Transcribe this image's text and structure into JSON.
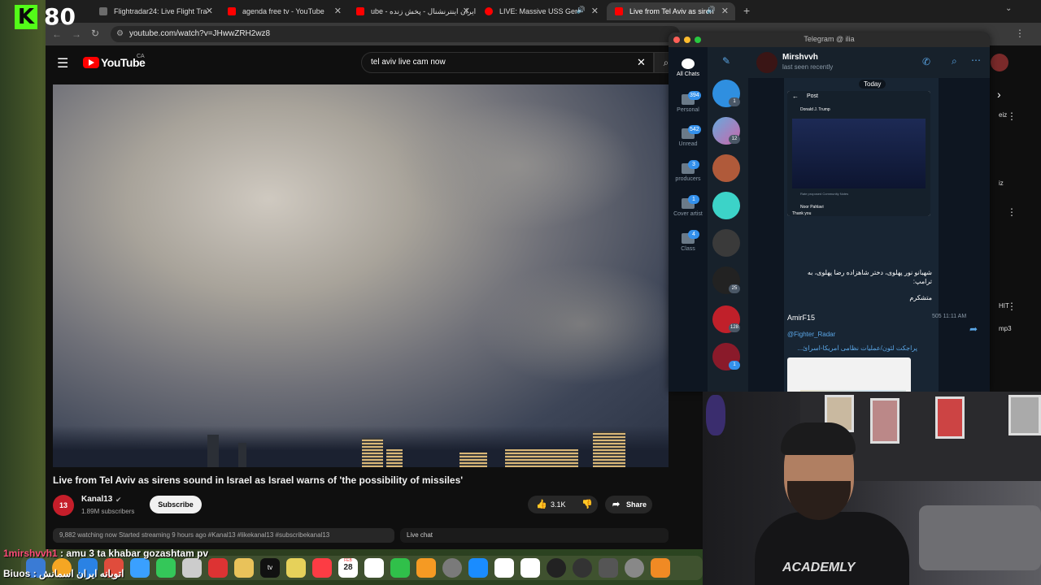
{
  "stream": {
    "kick_logo": "K",
    "viewer_count": "80"
  },
  "browser": {
    "tabs": [
      {
        "label": "Flightradar24: Live Flight Tra",
        "icon": "flightradar-icon",
        "color": "#6b6b6b"
      },
      {
        "label": "agenda free tv - YouTube",
        "icon": "youtube-icon",
        "color": "#ff0000"
      },
      {
        "label": "ube - ایران اینترنشنال - پخش زنده",
        "icon": "youtube-icon",
        "color": "#ff0000"
      },
      {
        "label": "LIVE: Massive USS Ger",
        "icon": "youtube-live-icon",
        "color": "#ff0000"
      },
      {
        "label": "Live from Tel Aviv as siren",
        "icon": "youtube-icon",
        "color": "#ff0000"
      }
    ],
    "url": "youtube.com/watch?v=JHwwZRH2wz8"
  },
  "youtube": {
    "logo_text": "YouTube",
    "country": "CA",
    "search_query": "tel aviv live cam now",
    "video_title": "Live from Tel Aviv as sirens sound in Israel as Israel warns of 'the possibility of missiles'",
    "channel_avatar_text": "13",
    "channel_name": "Kanal13",
    "subscribers": "1.89M subscribers",
    "subscribe_label": "Subscribe",
    "likes": "3.1K",
    "share_label": "Share",
    "meta": "9,882 watching now  Started streaming 9 hours ago  #Kanal13 #likekanal13 #subscribekanal13",
    "live_chat_label": "Live chat",
    "side_texts": [
      "eiz",
      "iz",
      "HIT",
      "mp3"
    ]
  },
  "telegram": {
    "window_title": "Telegram @ ilia",
    "folders": [
      {
        "label": "All Chats",
        "badge": ""
      },
      {
        "label": "Personal",
        "badge": "394"
      },
      {
        "label": "Unread",
        "badge": "542"
      },
      {
        "label": "producers",
        "badge": "3"
      },
      {
        "label": "Cover artist",
        "badge": "1"
      },
      {
        "label": "Class",
        "badge": "4"
      }
    ],
    "chat_badges": [
      "1",
      "12",
      "",
      "",
      "",
      "25",
      "128",
      "1"
    ],
    "peer_name": "Mirshvvh",
    "peer_status": "last seen recently",
    "post_label": "Post",
    "today_label": "Today",
    "tweet_author": "Donald J. Trump",
    "tweet_reply_author": "Noor Pahlavi",
    "tweet_reply_text": "Thank you",
    "community_notes": "Rate proposed Community Notes",
    "caption_line1": "شهبانو نور پهلوی، دختر شاهزاده رضا پهلوی، به ترامپ:",
    "caption_line2": "متشکرم",
    "sender": "AmirF15",
    "source_handle": "@Fighter_Radar",
    "link_text": "پراجکت لئون/عملیات نظامی آمریکا-اسرائ...",
    "views": "505 11:11 AM"
  },
  "dock": {
    "date_month": "FEB",
    "date_day": "28"
  },
  "chat_overlay": [
    {
      "user": "1mirshvvh1",
      "message": ": amu 3 ta khabar gozashtam pv"
    },
    {
      "user": "Biuos",
      "message": ": اتوبانه ایران اسمانش"
    }
  ],
  "webcam": {
    "shirt_text": "ACADEMLY"
  }
}
